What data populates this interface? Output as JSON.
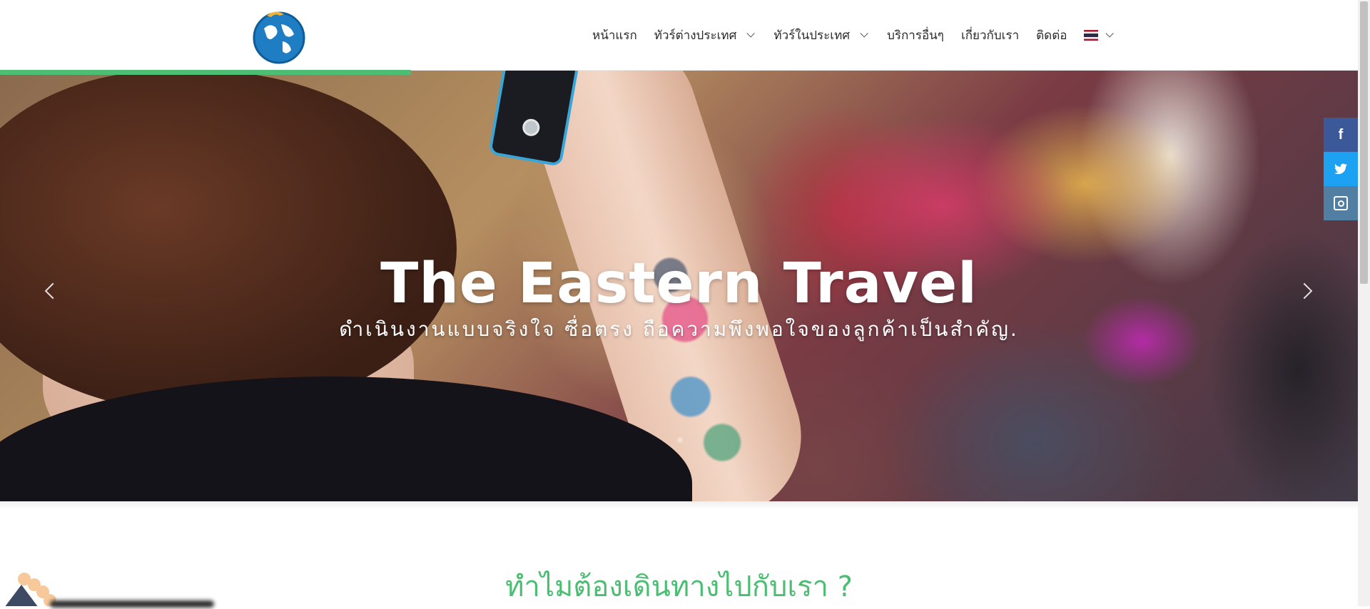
{
  "header": {
    "logo_name": "globe-logo",
    "nav": [
      {
        "label": "หน้าแรก",
        "has_dropdown": false
      },
      {
        "label": "ทัวร์ต่างประเทศ",
        "has_dropdown": true
      },
      {
        "label": "ทัวร์ในประเทศ",
        "has_dropdown": true
      },
      {
        "label": "บริการอื่นๆ",
        "has_dropdown": false
      },
      {
        "label": "เกี่ยวกับเรา",
        "has_dropdown": false
      },
      {
        "label": "ติดต่อ",
        "has_dropdown": false
      }
    ],
    "language_flag": "thai-flag-icon"
  },
  "hero": {
    "title": "The Eastern Travel",
    "subtitle": "ดำเนินงานแบบจริงใจ ซื่อตรง ถือความพึงพอใจของลูกค้าเป็นสำคัญ."
  },
  "social": {
    "facebook": "f",
    "twitter": "t",
    "instagram": "instagram-icon"
  },
  "section": {
    "title": "ทำไมต้องเดินทางไปกับเรา ?"
  },
  "colors": {
    "accent": "#4dbd74",
    "facebook": "#3b5998",
    "twitter": "#1da1f2",
    "instagram": "#517fa4"
  }
}
